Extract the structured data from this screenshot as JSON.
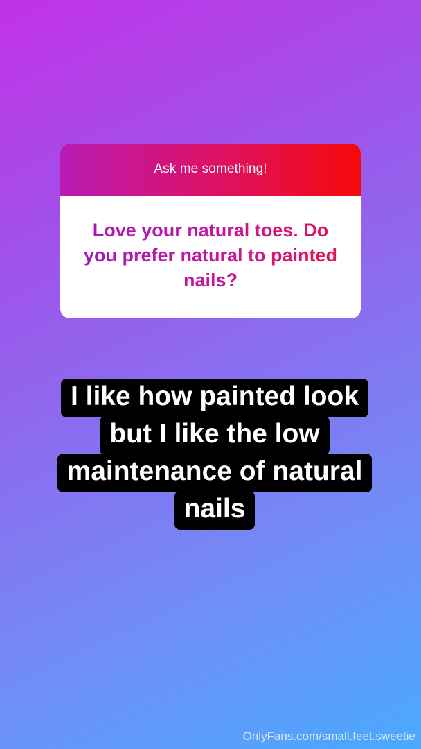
{
  "question_card": {
    "prompt": "Ask me something!",
    "question": "Love your natural toes. Do you prefer natural to painted nails?"
  },
  "answer": {
    "lines": [
      "I like how painted look",
      "but I like the low",
      "maintenance of natural",
      "nails"
    ]
  },
  "watermark": "OnlyFans.com/small.feet.sweetie",
  "colors": {
    "header_gradient": [
      "#b91bb4",
      "#f40a0a"
    ],
    "background_gradient": [
      "#c232e6",
      "#4aa9fe"
    ]
  }
}
